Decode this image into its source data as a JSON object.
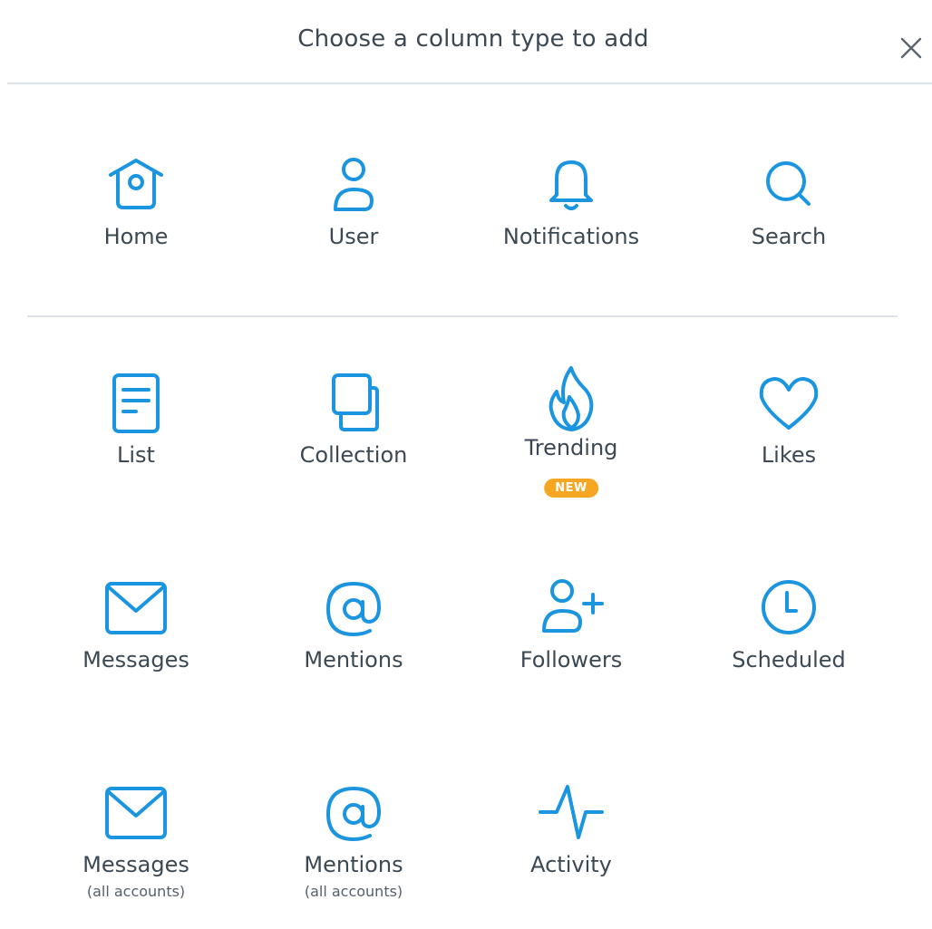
{
  "header": {
    "title": "Choose a column type to add"
  },
  "accent_color": "#1b95e0",
  "badge_color": "#f5a623",
  "columns": {
    "home": {
      "label": "Home",
      "icon": "home-icon"
    },
    "user": {
      "label": "User",
      "icon": "user-icon"
    },
    "notifications": {
      "label": "Notifications",
      "icon": "bell-icon"
    },
    "search": {
      "label": "Search",
      "icon": "search-icon"
    },
    "list": {
      "label": "List",
      "icon": "list-icon"
    },
    "collection": {
      "label": "Collection",
      "icon": "collection-icon"
    },
    "trending": {
      "label": "Trending",
      "badge": "NEW",
      "icon": "flame-icon"
    },
    "likes": {
      "label": "Likes",
      "icon": "heart-icon"
    },
    "messages": {
      "label": "Messages",
      "icon": "envelope-icon"
    },
    "mentions": {
      "label": "Mentions",
      "icon": "at-icon"
    },
    "followers": {
      "label": "Followers",
      "icon": "add-user-icon"
    },
    "scheduled": {
      "label": "Scheduled",
      "icon": "clock-icon"
    },
    "messages_all": {
      "label": "Messages",
      "sublabel": "(all accounts)",
      "icon": "envelope-icon"
    },
    "mentions_all": {
      "label": "Mentions",
      "sublabel": "(all accounts)",
      "icon": "at-icon"
    },
    "activity": {
      "label": "Activity",
      "icon": "activity-icon"
    }
  }
}
